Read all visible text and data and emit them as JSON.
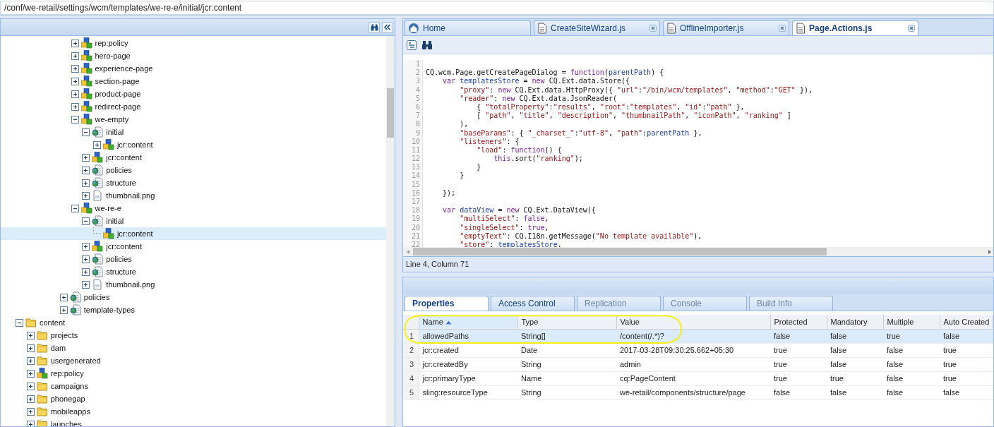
{
  "address_bar": {
    "value": "/conf/we-retail/settings/wcm/templates/we-re-e/initial/jcr:content"
  },
  "tree": {
    "items": [
      {
        "children": [
          {
            "children": [
              {
                "children": [
                  {
                    "children": [
                      {
                        "children": [
                          {
                            "label": "rep:policy",
                            "kind": "node",
                            "expanded": false,
                            "selected": false
                          },
                          {
                            "label": "hero-page",
                            "kind": "node",
                            "expanded": false,
                            "selected": false
                          },
                          {
                            "label": "experience-page",
                            "kind": "node",
                            "expanded": false,
                            "selected": false
                          },
                          {
                            "label": "section-page",
                            "kind": "node",
                            "expanded": false,
                            "selected": false
                          },
                          {
                            "label": "product-page",
                            "kind": "node",
                            "expanded": false,
                            "selected": false
                          },
                          {
                            "label": "redirect-page",
                            "kind": "node",
                            "expanded": false,
                            "selected": false
                          },
                          {
                            "label": "we-empty",
                            "kind": "node",
                            "expanded": true,
                            "selected": false,
                            "children": [
                              {
                                "label": "initial",
                                "kind": "page",
                                "expanded": true,
                                "selected": false,
                                "children": [
                                  {
                                    "label": "jcr:content",
                                    "kind": "node",
                                    "expanded": false,
                                    "selected": false
                                  }
                                ]
                              },
                              {
                                "label": "jcr:content",
                                "kind": "node",
                                "expanded": false,
                                "selected": false
                              },
                              {
                                "label": "policies",
                                "kind": "page",
                                "expanded": false,
                                "selected": false
                              },
                              {
                                "label": "structure",
                                "kind": "page",
                                "expanded": false,
                                "selected": false
                              },
                              {
                                "label": "thumbnail.png",
                                "kind": "file",
                                "expanded": false,
                                "selected": false
                              }
                            ]
                          },
                          {
                            "label": "we-re-e",
                            "kind": "node",
                            "expanded": true,
                            "selected": false,
                            "children": [
                              {
                                "label": "initial",
                                "kind": "page",
                                "expanded": true,
                                "selected": false,
                                "children": [
                                  {
                                    "label": "jcr:content",
                                    "kind": "node",
                                    "selected": true
                                  }
                                ]
                              },
                              {
                                "label": "jcr:content",
                                "kind": "node",
                                "expanded": false,
                                "selected": false
                              },
                              {
                                "label": "policies",
                                "kind": "page",
                                "expanded": false,
                                "selected": false
                              },
                              {
                                "label": "structure",
                                "kind": "page",
                                "expanded": false,
                                "selected": false
                              },
                              {
                                "label": "thumbnail.png",
                                "kind": "file",
                                "expanded": false,
                                "selected": false
                              }
                            ]
                          }
                        ]
                      },
                      {
                        "label": "policies",
                        "kind": "page",
                        "expanded": false,
                        "selected": false
                      },
                      {
                        "label": "template-types",
                        "kind": "page",
                        "expanded": false,
                        "selected": false
                      }
                    ]
                  }
                ]
              }
            ]
          }
        ]
      },
      {
        "label": "content",
        "kind": "folder",
        "expanded": true,
        "selected": false,
        "children": [
          {
            "label": "projects",
            "kind": "folder",
            "expanded": false,
            "selected": false
          },
          {
            "label": "dam",
            "kind": "folder",
            "expanded": false,
            "selected": false
          },
          {
            "label": "usergenerated",
            "kind": "folder",
            "expanded": false,
            "selected": false
          },
          {
            "label": "rep:policy",
            "kind": "node",
            "expanded": false,
            "selected": false
          },
          {
            "label": "campaigns",
            "kind": "folder",
            "expanded": false,
            "selected": false
          },
          {
            "label": "phonegap",
            "kind": "folder",
            "expanded": false,
            "selected": false
          },
          {
            "label": "mobileapps",
            "kind": "folder",
            "expanded": false,
            "selected": false
          },
          {
            "label": "launches",
            "kind": "folder",
            "expanded": false,
            "selected": false
          }
        ]
      }
    ]
  },
  "editor_tabs": [
    {
      "label": "Home",
      "kind": "home",
      "closable": false,
      "selected": false
    },
    {
      "label": "CreateSiteWizard.js",
      "kind": "file",
      "closable": true,
      "selected": false
    },
    {
      "label": "OfflineImporter.js",
      "kind": "file",
      "closable": true,
      "selected": false
    },
    {
      "label": "Page.Actions.js",
      "kind": "file",
      "closable": true,
      "selected": true
    }
  ],
  "code": {
    "lines": [
      {
        "number": "1"
      },
      {
        "number": "2",
        "text": "CQ.wcm.Page.getCreatePageDialog = function(parentPath) {"
      },
      {
        "number": "3",
        "text": "    var templatesStore = new CQ.Ext.data.Store({"
      },
      {
        "number": "4",
        "text": "        \"proxy\": new CQ.Ext.data.HttpProxy({ \"url\":\"/bin/wcm/templates\", \"method\":\"GET\" }),"
      },
      {
        "number": "5",
        "text": "        \"reader\": new CQ.Ext.data.JsonReader("
      },
      {
        "number": "6",
        "text": "            { \"totalProperty\":\"results\", \"root\":\"templates\", \"id\":\"path\" },"
      },
      {
        "number": "7",
        "text": "            [ \"path\", \"title\", \"description\", \"thumbnailPath\", \"iconPath\", \"ranking\" ]"
      },
      {
        "number": "8",
        "text": "        ),"
      },
      {
        "number": "9",
        "text": "        \"baseParams\": { \"_charset_\":\"utf-8\", \"path\":parentPath },"
      },
      {
        "number": "10",
        "text": "        \"listeners\": {"
      },
      {
        "number": "11",
        "text": "            \"load\": function() {"
      },
      {
        "number": "12",
        "text": "                this.sort(\"ranking\");"
      },
      {
        "number": "13",
        "text": "            }"
      },
      {
        "number": "14",
        "text": "        }"
      },
      {
        "number": "15"
      },
      {
        "number": "16",
        "text": "    });"
      },
      {
        "number": "17"
      },
      {
        "number": "18",
        "text": "    var dataView = new CQ.Ext.DataView({"
      },
      {
        "number": "19",
        "text": "        \"multiSelect\": false,"
      },
      {
        "number": "20",
        "text": "        \"singleSelect\": true,"
      },
      {
        "number": "21",
        "text": "        \"emptyText\": CQ.I18n.getMessage(\"No template available\"),"
      },
      {
        "number": "22",
        "text": "        \"store\": templatesStore,"
      }
    ]
  },
  "status_bar": {
    "text": "Line 4, Column 71"
  },
  "properties_tabs": [
    {
      "label": "Properties",
      "selected": true,
      "disabled": false
    },
    {
      "label": "Access Control",
      "selected": false,
      "disabled": false
    },
    {
      "label": "Replication",
      "selected": false,
      "disabled": true
    },
    {
      "label": "Console",
      "selected": false,
      "disabled": true
    },
    {
      "label": "Build Info",
      "selected": false,
      "disabled": true
    }
  ],
  "table": {
    "columns": [
      {
        "label": "Name",
        "sorted": true
      },
      {
        "label": "Type",
        "sorted": false
      },
      {
        "label": "Value",
        "sorted": false
      },
      {
        "label": "Protected",
        "sorted": false
      },
      {
        "label": "Mandatory",
        "sorted": false
      },
      {
        "label": "Multiple",
        "sorted": false
      },
      {
        "label": "Auto Created",
        "sorted": false
      }
    ],
    "rows": [
      {
        "number": "1",
        "selected": true,
        "cells": [
          "allowedPaths",
          "String[]",
          "/content(/.*)?",
          "false",
          "false",
          "true",
          "false"
        ]
      },
      {
        "number": "2",
        "selected": false,
        "cells": [
          "jcr:created",
          "Date",
          "2017-03-28T09:30:25.662+05:30",
          "true",
          "false",
          "false",
          "true"
        ]
      },
      {
        "number": "3",
        "selected": false,
        "cells": [
          "jcr:createdBy",
          "String",
          "admin",
          "true",
          "false",
          "false",
          "true"
        ]
      },
      {
        "number": "4",
        "selected": false,
        "cells": [
          "jcr:primaryType",
          "Name",
          "cq:PageContent",
          "true",
          "true",
          "false",
          "true"
        ]
      },
      {
        "number": "5",
        "selected": false,
        "cells": [
          "sling:resourceType",
          "String",
          "we-retail/components/structure/page",
          "false",
          "false",
          "false",
          "false"
        ]
      }
    ]
  }
}
